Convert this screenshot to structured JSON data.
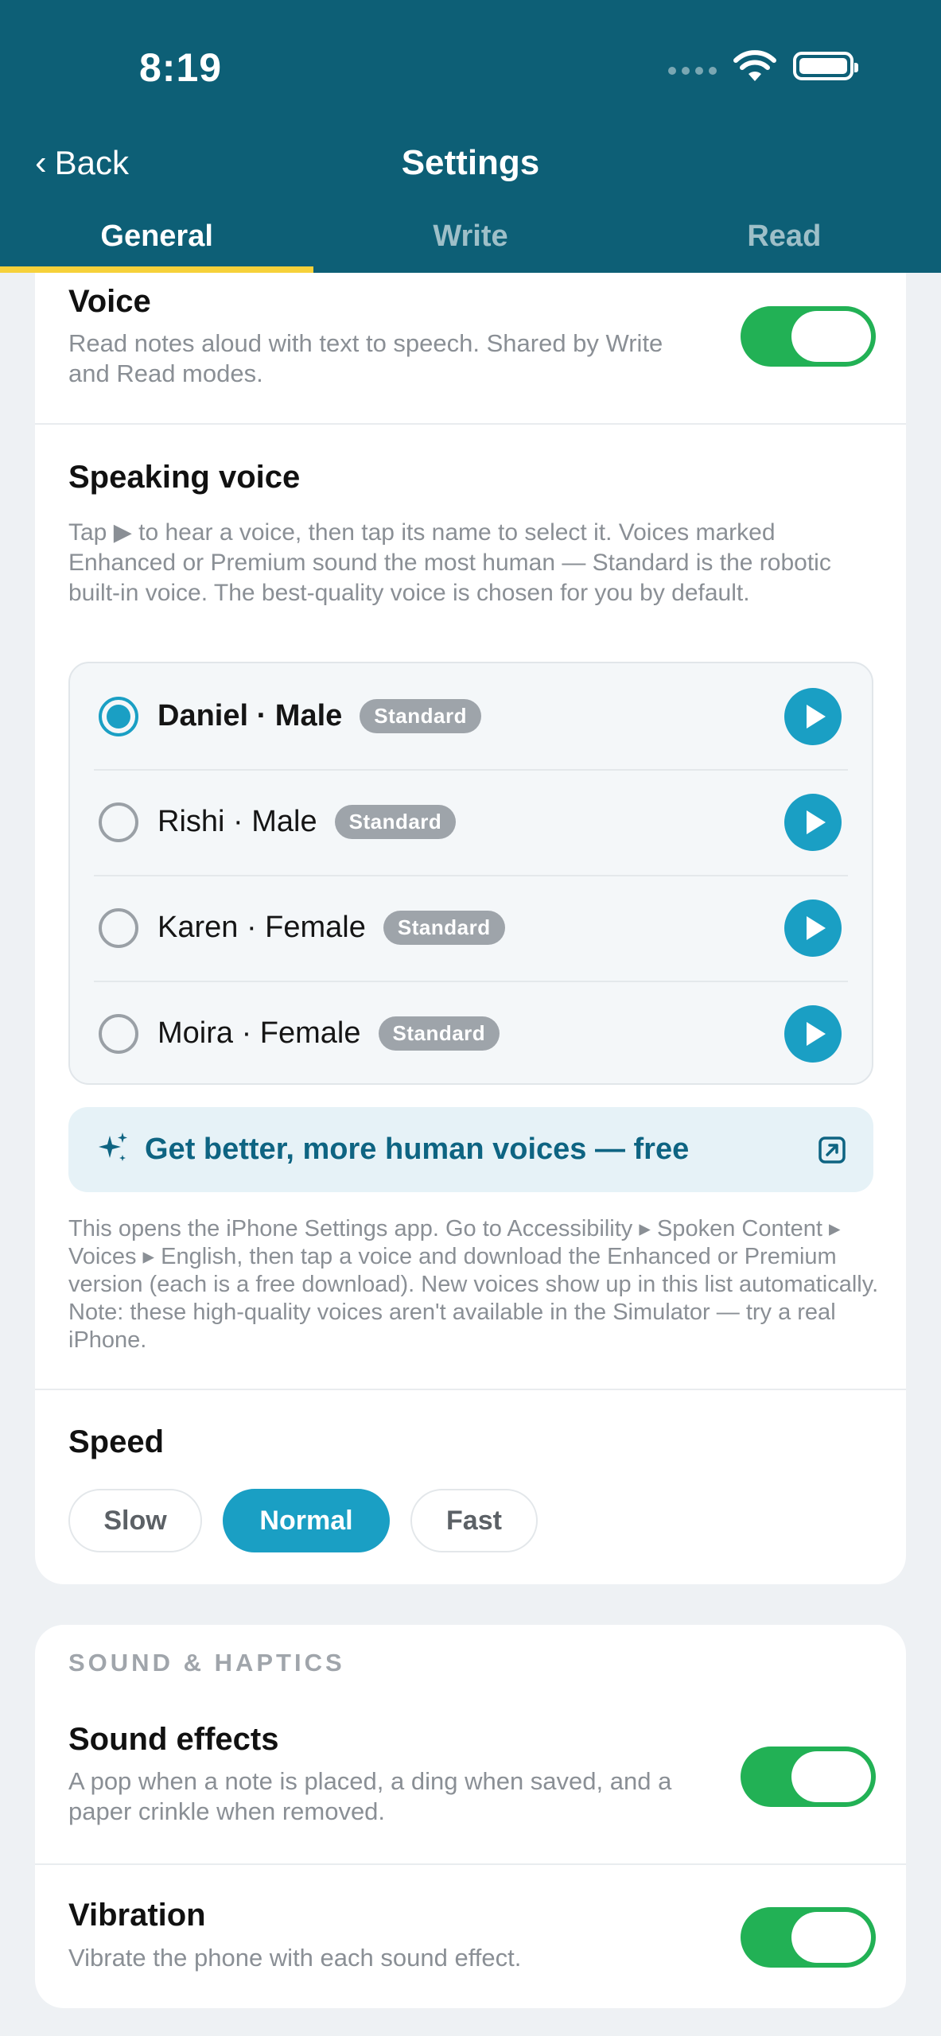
{
  "status_bar": {
    "time": "8:19"
  },
  "header": {
    "back_label": "Back",
    "title": "Settings",
    "back_icon": "chevron-left-icon"
  },
  "tabs": [
    {
      "label": "General",
      "active": true
    },
    {
      "label": "Write",
      "active": false
    },
    {
      "label": "Read",
      "active": false
    }
  ],
  "voice": {
    "title": "Voice",
    "description": "Read notes aloud with text to speech. Shared by Write and Read modes.",
    "enabled": true
  },
  "speaking_voice": {
    "title": "Speaking voice",
    "description": "Tap ▶ to hear a voice, then tap its name to select it. Voices marked Enhanced or Premium sound the most human — Standard is the robotic built-in voice. The best-quality voice is chosen for you by default.",
    "voices": [
      {
        "name": "Daniel · Male",
        "badge": "Standard",
        "selected": true
      },
      {
        "name": "Rishi · Male",
        "badge": "Standard",
        "selected": false
      },
      {
        "name": "Karen · Female",
        "badge": "Standard",
        "selected": false
      },
      {
        "name": "Moira · Female",
        "badge": "Standard",
        "selected": false
      }
    ]
  },
  "promo": {
    "label": "Get better, more human voices — free",
    "note": "This opens the iPhone Settings app. Go to Accessibility ▸ Spoken Content ▸ Voices ▸ English, then tap a voice and download the Enhanced or Premium version (each is a free download). New voices show up in this list automatically. Note: these high-quality voices aren't available in the Simulator — try a real iPhone."
  },
  "speed": {
    "title": "Speed",
    "options": [
      {
        "label": "Slow",
        "active": false
      },
      {
        "label": "Normal",
        "active": true
      },
      {
        "label": "Fast",
        "active": false
      }
    ]
  },
  "sound_haptics": {
    "section_label": "SOUND & HAPTICS",
    "sound_effects": {
      "title": "Sound effects",
      "description": "A pop when a note is placed, a ding when saved, and a paper crinkle when removed.",
      "enabled": true
    },
    "vibration": {
      "title": "Vibration",
      "description": "Vibrate the phone with each sound effect.",
      "enabled": true
    }
  },
  "colors": {
    "header_bg": "#0d5f76",
    "accent": "#1a9fc4",
    "toggle_on": "#22b155",
    "tab_indicator": "#f6d13a"
  }
}
